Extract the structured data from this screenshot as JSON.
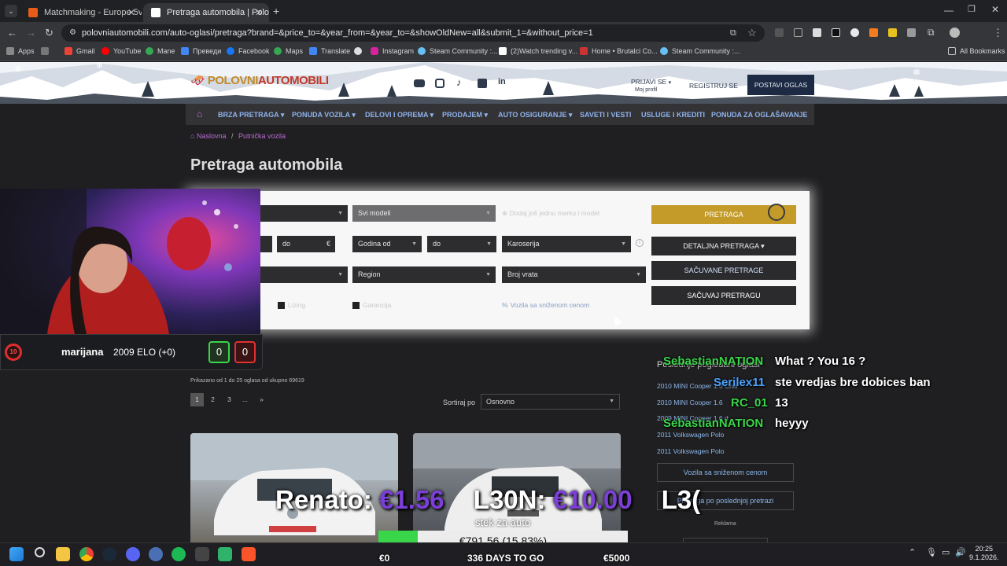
{
  "browser": {
    "tabs": [
      {
        "label": "Matchmaking - Europe 5v5 Qu",
        "active": false,
        "favicon_color": "#e85c1a"
      },
      {
        "label": "Pretraga automobila | Polovni a",
        "active": true,
        "favicon_color": "#ffffff"
      }
    ],
    "new_tab_label": "+",
    "url": "polovniautomobili.com/auto-oglasi/pretraga?brand=&price_to=&year_from=&year_to=&showOldNew=all&submit_1=&without_price=1",
    "bookmarks": [
      {
        "label": "Apps",
        "color": "#888888"
      },
      {
        "label": "Gmail",
        "color": "#ea4335"
      },
      {
        "label": "YouTube",
        "color": "#ff0000"
      },
      {
        "label": "Mane",
        "color": "#34a853"
      },
      {
        "label": "Преведи",
        "color": "#4285f4"
      },
      {
        "label": "Facebook",
        "color": "#1877f2"
      },
      {
        "label": "Maps",
        "color": "#34a853"
      },
      {
        "label": "Translate",
        "color": "#4285f4"
      },
      {
        "label": "",
        "color": "#dddddd"
      },
      {
        "label": "Instagram",
        "color": "#d6249f"
      },
      {
        "label": "Steam Community :...",
        "color": "#66c0f4"
      },
      {
        "label": "(2)Watch trending v...",
        "color": "#ffffff"
      },
      {
        "label": "Home • Brutalci Co...",
        "color": "#cc3333"
      },
      {
        "label": "Steam Community :...",
        "color": "#66c0f4"
      }
    ],
    "all_bookmarks": "All Bookmarks"
  },
  "site": {
    "logo_part1": "POLOVNI",
    "logo_part2": "AUTOMOBILI",
    "login": "PRIJAVI SE",
    "my_profile": "Moj profil",
    "register": "REGISTRUJ SE",
    "post_ad": "POSTAVI OGLAS",
    "nav": [
      {
        "label": "BRZA PRETRAGA ▾"
      },
      {
        "label": "PONUDA VOZILA ▾"
      },
      {
        "label": "DELOVI I OPREMA ▾"
      },
      {
        "label": "PRODAJEM ▾"
      },
      {
        "label": "AUTO OSIGURANJE ▾"
      },
      {
        "label": "SAVETI I VESTI"
      },
      {
        "label": "USLUGE I KREDITI"
      },
      {
        "label": "PONUDA ZA OGLAŠAVANJE"
      }
    ],
    "breadcrumb_home": "Naslovna",
    "breadcrumb_sep": "/",
    "breadcrumb_current": "Putnička vozila",
    "page_title": "Pretraga automobila"
  },
  "search": {
    "models": "Svi modeli",
    "add_brand": "Dodaj još jednu marku i model",
    "price_to": "do",
    "currency": "€",
    "year_from": "Godina od",
    "year_to": "do",
    "body": "Karoserija",
    "region": "Region",
    "doors": "Broj vrata",
    "leasing": "Lizing",
    "warranty": "Garancija",
    "discounted": "Vozila sa sniženom cenom",
    "btn_search": "PRETRAGA",
    "btn_detailed": "DETALJNA PRETRAGA ▾",
    "btn_saved": "SAČUVANE PRETRAGE",
    "btn_save": "SAČUVAJ PRETRAGU"
  },
  "results": {
    "summary": "Prikazano od 1 do 25 oglasa od ukupno 69619",
    "pages": [
      "1",
      "2",
      "3",
      "...",
      "»"
    ],
    "sort_label": "Sortiraj po",
    "sort_value": "Osnovno"
  },
  "sidebar": {
    "title": "Poslednje pogledani oglasi",
    "recent": [
      "2010 MINI Cooper 1.6 Chili",
      "2010 MINI Cooper 1.6",
      "2009 MINI Cooper 1.6 d",
      "2011 Volkswagen Polo",
      "2011 Volkswagen Polo"
    ],
    "btn_discounted": "Vozila sa sniženom cenom",
    "btn_last_search": "Pretraga po poslednjoj pretrazi",
    "ad_label": "Reklama"
  },
  "stream": {
    "player_name": "marijana",
    "elo": "2009 ELO (+0)",
    "level": "10",
    "wins": "0",
    "losses": "0",
    "chat": [
      {
        "user": "SebastianNATION",
        "message": "What ? You 16 ?",
        "color": "#3ad64a"
      },
      {
        "user": "Serilex11",
        "message": "ste vredjas bre dobices ban",
        "color": "#4aa3ff"
      },
      {
        "user": "RC_01",
        "message": "13",
        "color": "#3ad64a"
      },
      {
        "user": "SebastianNATION",
        "message": "heyyy",
        "color": "#3ad64a"
      }
    ],
    "ticker": [
      {
        "name": "Renato:",
        "amount": "€1.56"
      },
      {
        "name": "L30N:",
        "amount": "€10.00"
      },
      {
        "name": "L3(",
        "amount": ""
      }
    ],
    "goal_label": "stek za auto",
    "goal_text": "€791.56 (15.83%)",
    "goal_progress": 0.1583,
    "goal_min": "€0",
    "goal_days": "336 DAYS TO GO",
    "goal_max": "€5000"
  },
  "taskbar": {
    "time": "20:25",
    "date": "9.1.2026."
  }
}
